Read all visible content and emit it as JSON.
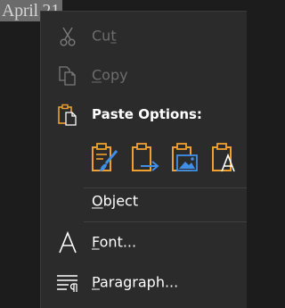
{
  "document": {
    "text": "April 21"
  },
  "menu": {
    "cut": {
      "pre": "Cu",
      "key": "t",
      "post": ""
    },
    "copy": {
      "pre": "",
      "key": "C",
      "post": "opy"
    },
    "paste_options": {
      "label": "Paste Options:"
    },
    "object": {
      "pre": "",
      "key": "O",
      "post": "bject"
    },
    "font": {
      "pre": "",
      "key": "F",
      "post": "ont..."
    },
    "paragraph": {
      "pre": "",
      "key": "P",
      "post": "aragraph..."
    }
  },
  "paste_buttons": [
    {
      "name": "keep-source-formatting",
      "icon": "clipboard-brush-icon"
    },
    {
      "name": "merge-formatting",
      "icon": "clipboard-arrow-icon"
    },
    {
      "name": "picture",
      "icon": "clipboard-picture-icon"
    },
    {
      "name": "keep-text-only",
      "icon": "clipboard-text-icon"
    }
  ],
  "colors": {
    "accent": "#f0a030",
    "link_blue": "#3f8ee8",
    "disabled": "#6d6d6d"
  }
}
